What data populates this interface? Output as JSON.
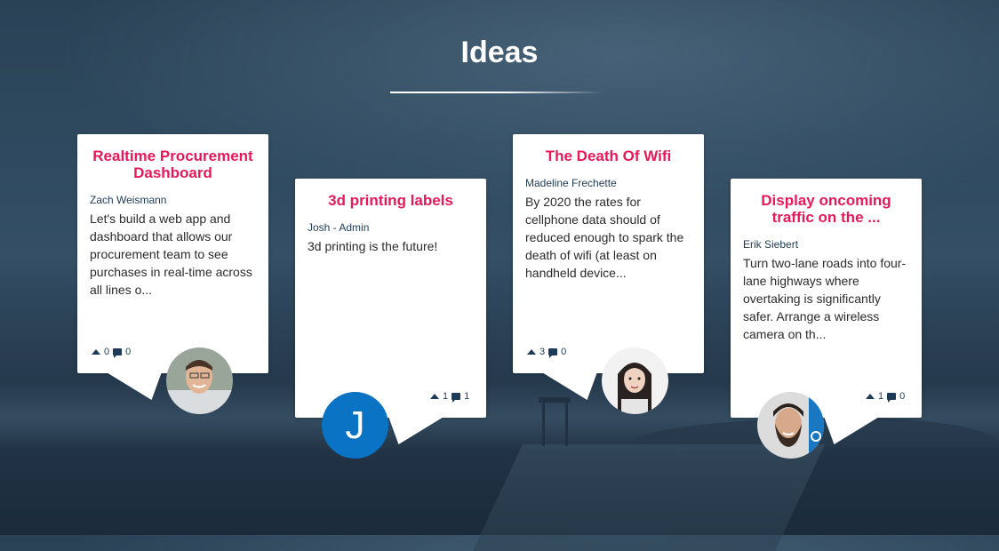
{
  "page": {
    "title": "Ideas"
  },
  "ideas": [
    {
      "title": "Realtime Procurement Dashboard",
      "author": "Zach Weismann",
      "body": "Let's build a web app and dashboard that allows our procurement team to see purchases in real-time across all lines o...",
      "upvotes": "0",
      "comments": "0"
    },
    {
      "title": "3d printing labels",
      "author": "Josh - Admin",
      "body": "3d printing is the future!",
      "upvotes": "1",
      "comments": "1",
      "avatar_letter": "J"
    },
    {
      "title": "The Death Of Wifi",
      "author": "Madeline Frechette",
      "body": "By 2020 the rates for cellphone data should of reduced enough to spark the death of wifi (at least on handheld device...",
      "upvotes": "3",
      "comments": "0"
    },
    {
      "title": "Display oncoming traffic on the ...",
      "author": "Erik Siebert",
      "body": "Turn two-lane roads into four-lane highways where overtaking is significantly safer. Arrange a wireless camera on th...",
      "upvotes": "1",
      "comments": "0"
    }
  ],
  "colors": {
    "title_accent": "#e8185a",
    "author_text": "#1d3b57",
    "avatar_letter_bg": "#0b73c4"
  },
  "icons": [
    "upvote-icon",
    "comment-icon"
  ]
}
